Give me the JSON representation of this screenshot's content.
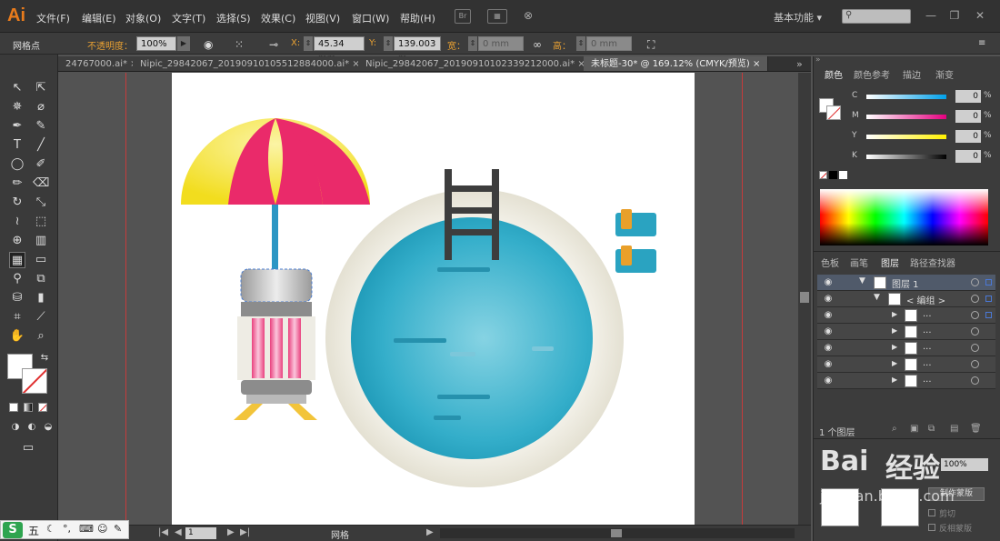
{
  "app": {
    "logo": "Ai",
    "menus": [
      "文件(F)",
      "编辑(E)",
      "对象(O)",
      "文字(T)",
      "选择(S)",
      "效果(C)",
      "视图(V)",
      "窗口(W)",
      "帮助(H)"
    ],
    "mini_icon": "Br",
    "workspace": "基本功能",
    "workspace_arrow": "▾",
    "window_buttons": [
      "—",
      "❐",
      "✕"
    ]
  },
  "control_bar": {
    "object_type": "网格点",
    "opacity_label": "不透明度：",
    "opacity_value": "100%",
    "x_label": "X:",
    "x_value": "45.34 mm",
    "y_label": "Y:",
    "y_value": "139.003 m",
    "w_label": "宽：",
    "w_value": "0 mm",
    "h_label": "高：",
    "h_value": "0 mm"
  },
  "doc_tabs": [
    {
      "label": "24767000.ai*",
      "close": "×"
    },
    {
      "label": "Nipic_29842067_20190910105512884000.ai*",
      "close": "×"
    },
    {
      "label": "Nipic_29842067_20190910102339212000.ai*",
      "close": "×"
    },
    {
      "label": "未标题-30* @ 169.12% (CMYK/预览)",
      "close": "×"
    }
  ],
  "tab_overflow": "»",
  "status_bar": {
    "page": "1",
    "tool_name": "网格"
  },
  "color_panel": {
    "tabs": [
      "颜色",
      "颜色参考",
      "描边",
      "渐变"
    ],
    "channels": [
      {
        "key": "C",
        "value": "0",
        "pct": "%",
        "gradient": "linear-gradient(to right,#fff,#00a0e9)"
      },
      {
        "key": "M",
        "value": "0",
        "pct": "%",
        "gradient": "linear-gradient(to right,#fff,#e4007f)"
      },
      {
        "key": "Y",
        "value": "0",
        "pct": "%",
        "gradient": "linear-gradient(to right,#fff,#fff100)"
      },
      {
        "key": "K",
        "value": "0",
        "pct": "%",
        "gradient": "linear-gradient(to right,#fff,#000)"
      }
    ]
  },
  "layers_panel": {
    "tabs": [
      "色板",
      "画笔",
      "图层",
      "路径查找器"
    ],
    "rows": [
      {
        "name": "图层 1"
      },
      {
        "name": "< 编组 >"
      },
      {
        "name": "..."
      },
      {
        "name": "..."
      },
      {
        "name": "..."
      },
      {
        "name": "..."
      },
      {
        "name": "..."
      }
    ],
    "count": "1 个图层"
  },
  "transparency_panel": {
    "value": "100%",
    "make_mask_button": "制作蒙版",
    "clip_label": "剪切",
    "invert_label": "反相蒙版"
  },
  "watermark": {
    "text": "经验",
    "latin": "Bai",
    "sub": "jingyan.baidu.com"
  },
  "ime": {
    "logo": "S",
    "text": "五",
    "items": [
      "☾",
      "°,",
      "⌨",
      "☺",
      "✎"
    ]
  },
  "colors": {
    "umbrella_yellow": "#f5e53c",
    "umbrella_pink": "#ea2a6a",
    "pool_blue": "#2aa8c4",
    "pool_rim": "#e6e3d6",
    "ladder": "#3d3d3d",
    "stand_pink": "#f08cb8",
    "stand_gray": "#8c8c8c",
    "towel_blue": "#2aa3c1",
    "towel_orange": "#e9a02a"
  }
}
